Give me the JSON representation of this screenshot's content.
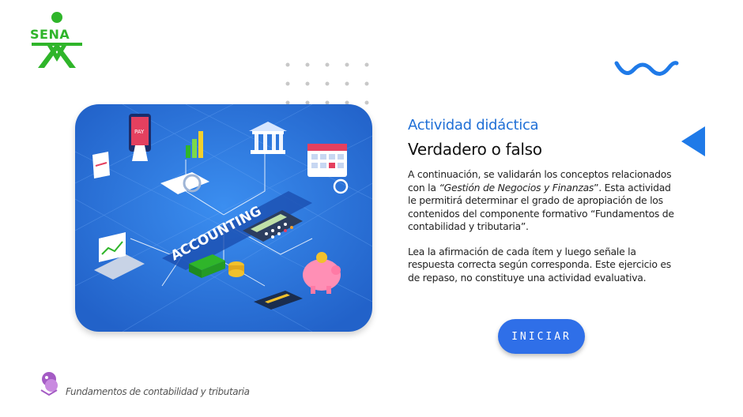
{
  "brand": {
    "logo_text": "SENA",
    "logo_color": "#2fb52a"
  },
  "content": {
    "subtitle": "Actividad didáctica",
    "title": "Verdadero o falso",
    "paragraph1_a": "A continuación, se validarán los conceptos relacionados con la ",
    "paragraph1_em": "“Gestión de Negocios y Finanzas",
    "paragraph1_b": "”.  Esta actividad le permitirá determinar el grado de apropiación de los contenidos del componente formativo “Fundamentos de contabilidad y tributaria”.",
    "paragraph2": "Lea la afirmación de cada ítem y luego señale la respuesta correcta según corresponda.  Este ejercicio es de repaso, no constituye una actividad evaluativa."
  },
  "actions": {
    "start_label": "INICIAR"
  },
  "illustration": {
    "center_label": "ACCOUNTING",
    "pay_label": "PAY"
  },
  "footer": {
    "course_name": "Fundamentos de contabilidad y tributaria"
  },
  "colors": {
    "accent": "#1f6fd6",
    "button": "#2f6fe8",
    "illustration_bg": "#2b74e0",
    "footer_icon": "#a45bc4"
  },
  "icons": {
    "logo": "sena-logo-icon",
    "wave": "wave-decoration-icon",
    "nav": "triangle-left-icon",
    "footer": "footer-mascot-icon"
  }
}
